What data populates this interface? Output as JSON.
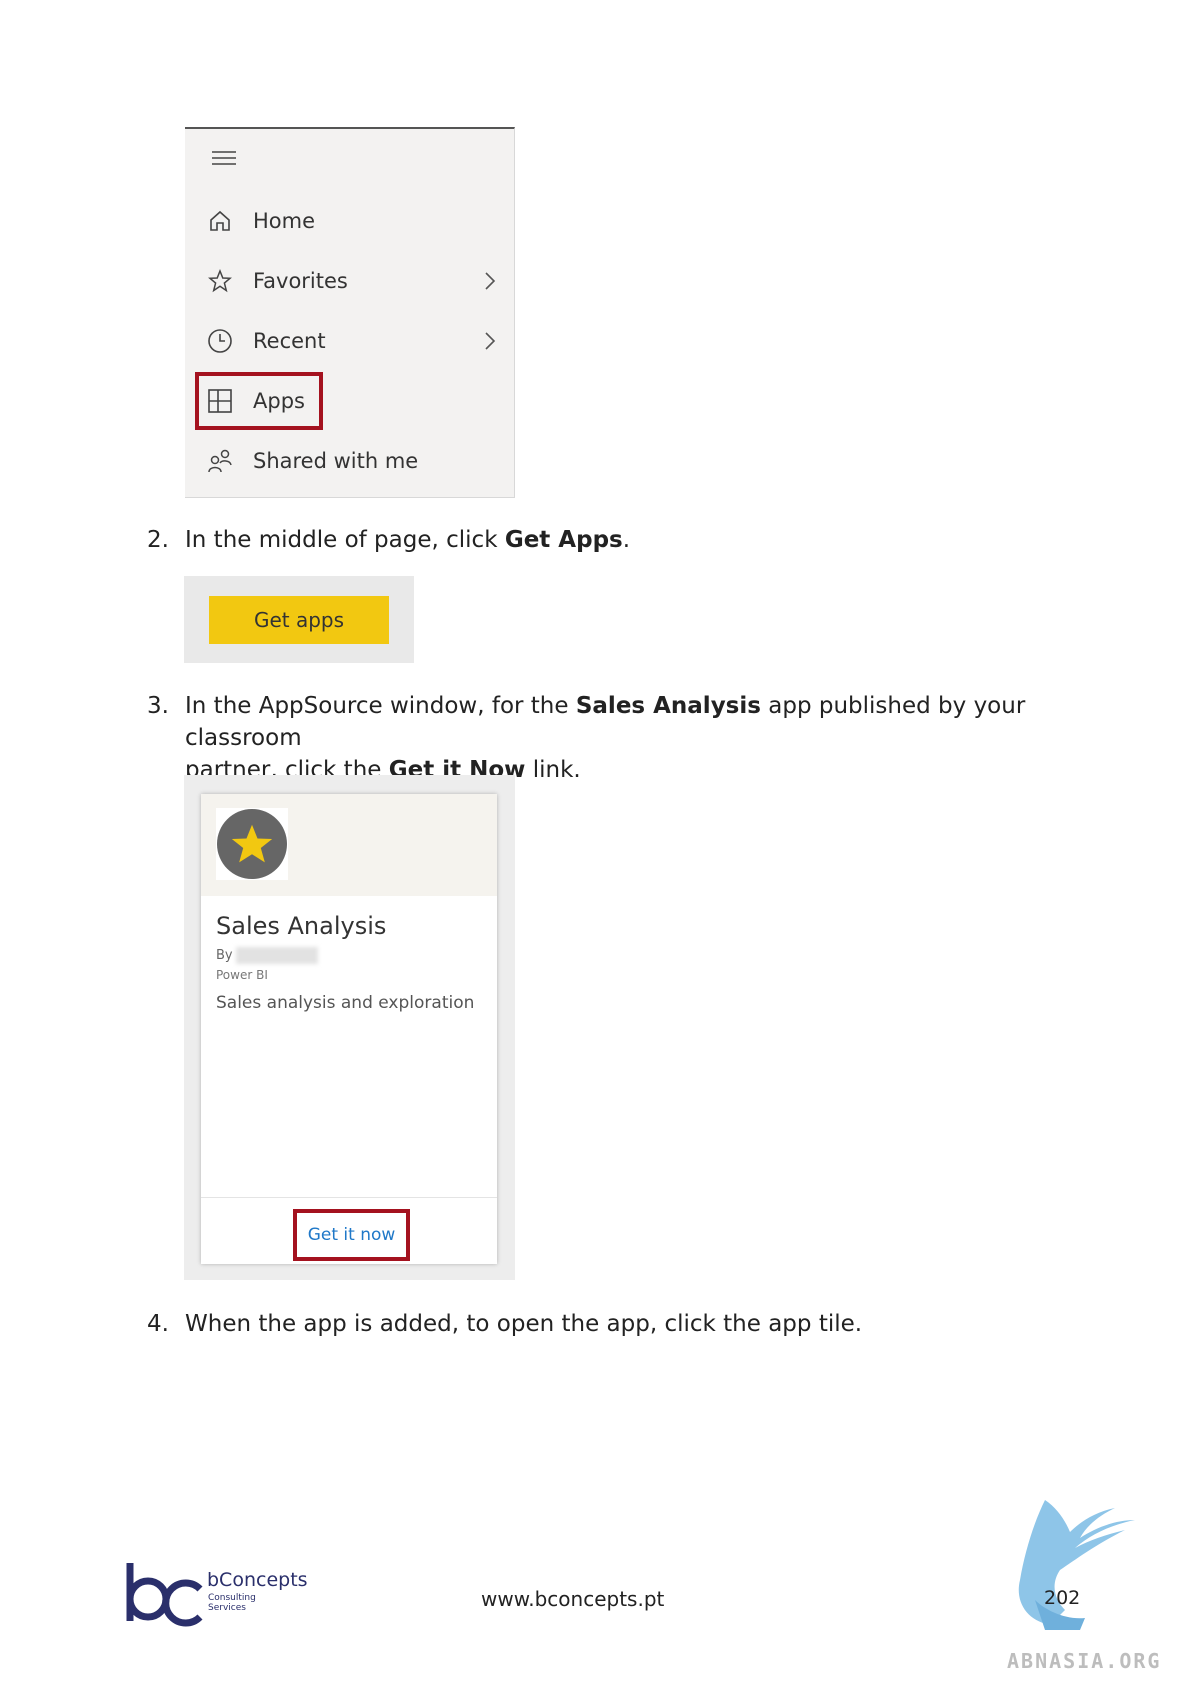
{
  "nav_menu": {
    "items": [
      {
        "label": "Home",
        "icon": "home-icon",
        "has_chevron": false
      },
      {
        "label": "Favorites",
        "icon": "star-icon",
        "has_chevron": true
      },
      {
        "label": "Recent",
        "icon": "clock-icon",
        "has_chevron": true
      },
      {
        "label": "Apps",
        "icon": "apps-icon",
        "has_chevron": false,
        "highlighted": true
      },
      {
        "label": "Shared with me",
        "icon": "shared-icon",
        "has_chevron": false
      }
    ],
    "highlight_color": "#a4121f"
  },
  "steps": {
    "step2": {
      "num": "2.",
      "pre": "In the middle of page, click ",
      "bold": "Get Apps",
      "post": "."
    },
    "step3": {
      "num": "3.",
      "line1_pre": "In the AppSource window, for the ",
      "line1_bold": "Sales Analysis",
      "line1_post": " app published by your classroom",
      "line2_pre": "partner, click the ",
      "line2_bold": "Get it Now",
      "line2_post": " link."
    },
    "step4": {
      "num": "4.",
      "text": "When the app is added, to open the app, click the app tile."
    }
  },
  "get_apps_button": {
    "label": "Get apps",
    "color": "#f2c811"
  },
  "app_card": {
    "title": "Sales Analysis",
    "by_label": "By",
    "publisher": "Power BI",
    "description": "Sales analysis and exploration",
    "link_label": "Get it now",
    "link_color": "#1f78c8"
  },
  "footer": {
    "url": "www.bconcepts.pt",
    "page_number": "202",
    "brand_name": "bConcepts",
    "brand_tag1": "Consulting",
    "brand_tag2": "Services",
    "watermark": "ABNASIA.ORG"
  }
}
